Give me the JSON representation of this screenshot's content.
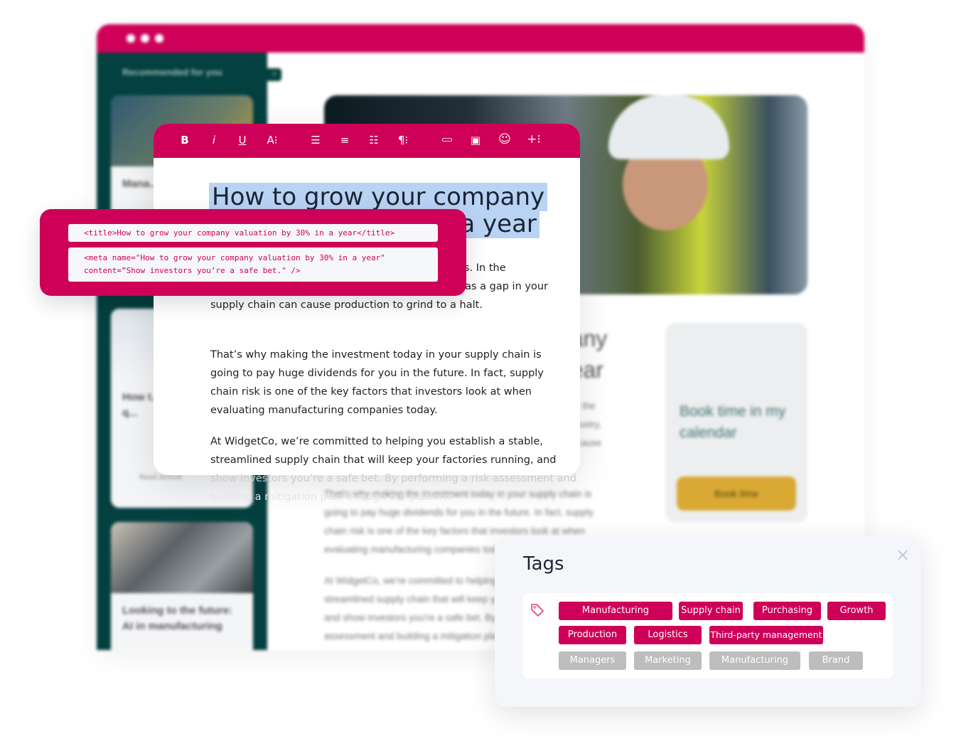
{
  "colors": {
    "accent": "#cf0058",
    "sidebar": "#03403f",
    "selection": "#b9d3f5",
    "book_button": "#d9a934",
    "inactive_tag": "#bdbdbd"
  },
  "background": {
    "sidebar": {
      "heading": "Recommended for you",
      "cards": [
        {
          "title": "Mana... entire..."
        },
        {
          "title": "How t... your s... one q...",
          "link": "Read Article"
        },
        {
          "title": "Looking to the future: AI in manufacturing"
        }
      ]
    },
    "article": {
      "heading": [
        "...any",
        "...ear"
      ],
      "lines": [
        "...s are the",
        "...g industry,",
        "...can cause",
        "That's why making the investment today in your supply chain is",
        "going to pay huge dividends for you in the future. In fact, supply",
        "chain risk is one of the key factors that investors look at when",
        "evaluating manufacturing companies today.",
        "At WidgetCo, we're committed to helping you establish a stable,",
        "streamlined supply chain that will keep your factories running,",
        "and show investors you're a safe bet. By performing a risk",
        "assessment and building a mitigation plan..."
      ]
    },
    "book": {
      "title": "Book time in my calendar",
      "button": "Book time"
    }
  },
  "editor": {
    "toolbar": [
      {
        "icon": "bold-icon",
        "glyph": "B"
      },
      {
        "icon": "italic-icon",
        "glyph": "i"
      },
      {
        "icon": "underline-icon",
        "glyph": "U"
      },
      {
        "icon": "font-size-icon",
        "glyph": "A⁝"
      },
      {
        "icon": "align-left-icon",
        "glyph": "☰"
      },
      {
        "icon": "align-center-icon",
        "glyph": "≡"
      },
      {
        "icon": "numbered-list-icon",
        "glyph": "☷"
      },
      {
        "icon": "paragraph-icon",
        "glyph": "¶⁝"
      },
      {
        "icon": "link-icon",
        "glyph": "⊂⊃"
      },
      {
        "icon": "image-icon",
        "glyph": "▣"
      },
      {
        "icon": "emoji-icon",
        "glyph": "☺"
      },
      {
        "icon": "insert-more-icon",
        "glyph": "+⁝"
      }
    ],
    "title_line1": "How to grow your company",
    "title_line2": "valuation by 30% in a year",
    "paragraphs": [
      "Supply chains are the backbone of every business. In the manufacturing industry, it’s even more essential as a gap in your supply chain can cause production to grind to a halt.",
      "That’s why making the investment today in your supply chain is going to pay huge dividends for you in the future. In fact, supply chain risk is one of the key factors that investors look at when evaluating manufacturing companies today.",
      "At WidgetCo, we’re committed to helping you establish a stable, streamlined supply chain that will keep your factories running, and"
    ],
    "faded_lines": [
      "show investors you’re a safe bet. By performing a risk assessment and",
      "building a mitigation plan through our platform"
    ]
  },
  "seo": {
    "title_tag": "<title>How to grow your company valuation by 30% in a year</title>",
    "meta_line1": "<meta name=\"How to grow your company valuation by 30% in a year\"",
    "meta_line2": "content=”Show investors you’re a safe bet.\" />"
  },
  "tags": {
    "title": "Tags",
    "active": [
      "Manufacturing",
      "Supply chain",
      "Purchasing",
      "Growth",
      "Production",
      "Logistics",
      "Third-party management"
    ],
    "inactive": [
      "Managers",
      "Marketing",
      "Manufacturing",
      "Brand"
    ]
  }
}
